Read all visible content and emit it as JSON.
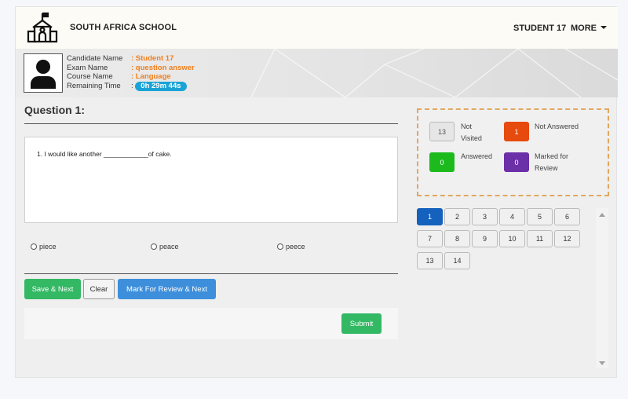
{
  "header": {
    "school_name": "SOUTH AFRICA SCHOOL",
    "student_name": "STUDENT 17",
    "more_label": "MORE"
  },
  "candidate": {
    "name_label": "Candidate Name",
    "name_value": ": Student 17",
    "exam_label": "Exam Name",
    "exam_value": ": question answer",
    "course_label": "Course Name",
    "course_value": ": Language",
    "time_label": "Remaining Time",
    "time_sep": ":",
    "time_value": "0h 29m 44s"
  },
  "question": {
    "title": "Question 1:",
    "text": "1. I would like another ____________of cake.",
    "options": [
      "piece",
      "peace",
      "peece"
    ]
  },
  "buttons": {
    "save_next": "Save & Next",
    "clear": "Clear",
    "mark_review": "Mark For Review & Next",
    "submit": "Submit"
  },
  "legend": {
    "not_visited_count": "13",
    "not_visited_label_1": "Not",
    "not_visited_label_2": "Visited",
    "not_answered_count": "1",
    "not_answered_label": "Not Answered",
    "answered_count": "0",
    "answered_label": "Answered",
    "marked_count": "0",
    "marked_label_1": "Marked for",
    "marked_label_2": "Review",
    "colors": {
      "not_visited": "#e6e6e6",
      "not_answered": "#e64a0c",
      "answered": "#1dba1d",
      "marked": "#6b2fa8"
    }
  },
  "palette": {
    "questions": [
      "1",
      "2",
      "3",
      "4",
      "5",
      "6",
      "7",
      "8",
      "9",
      "10",
      "11",
      "12",
      "13",
      "14"
    ],
    "current": "1",
    "current_color": "#1461be"
  },
  "icons": {
    "logo": "school-building-icon",
    "avatar": "user-silhouette-icon"
  }
}
